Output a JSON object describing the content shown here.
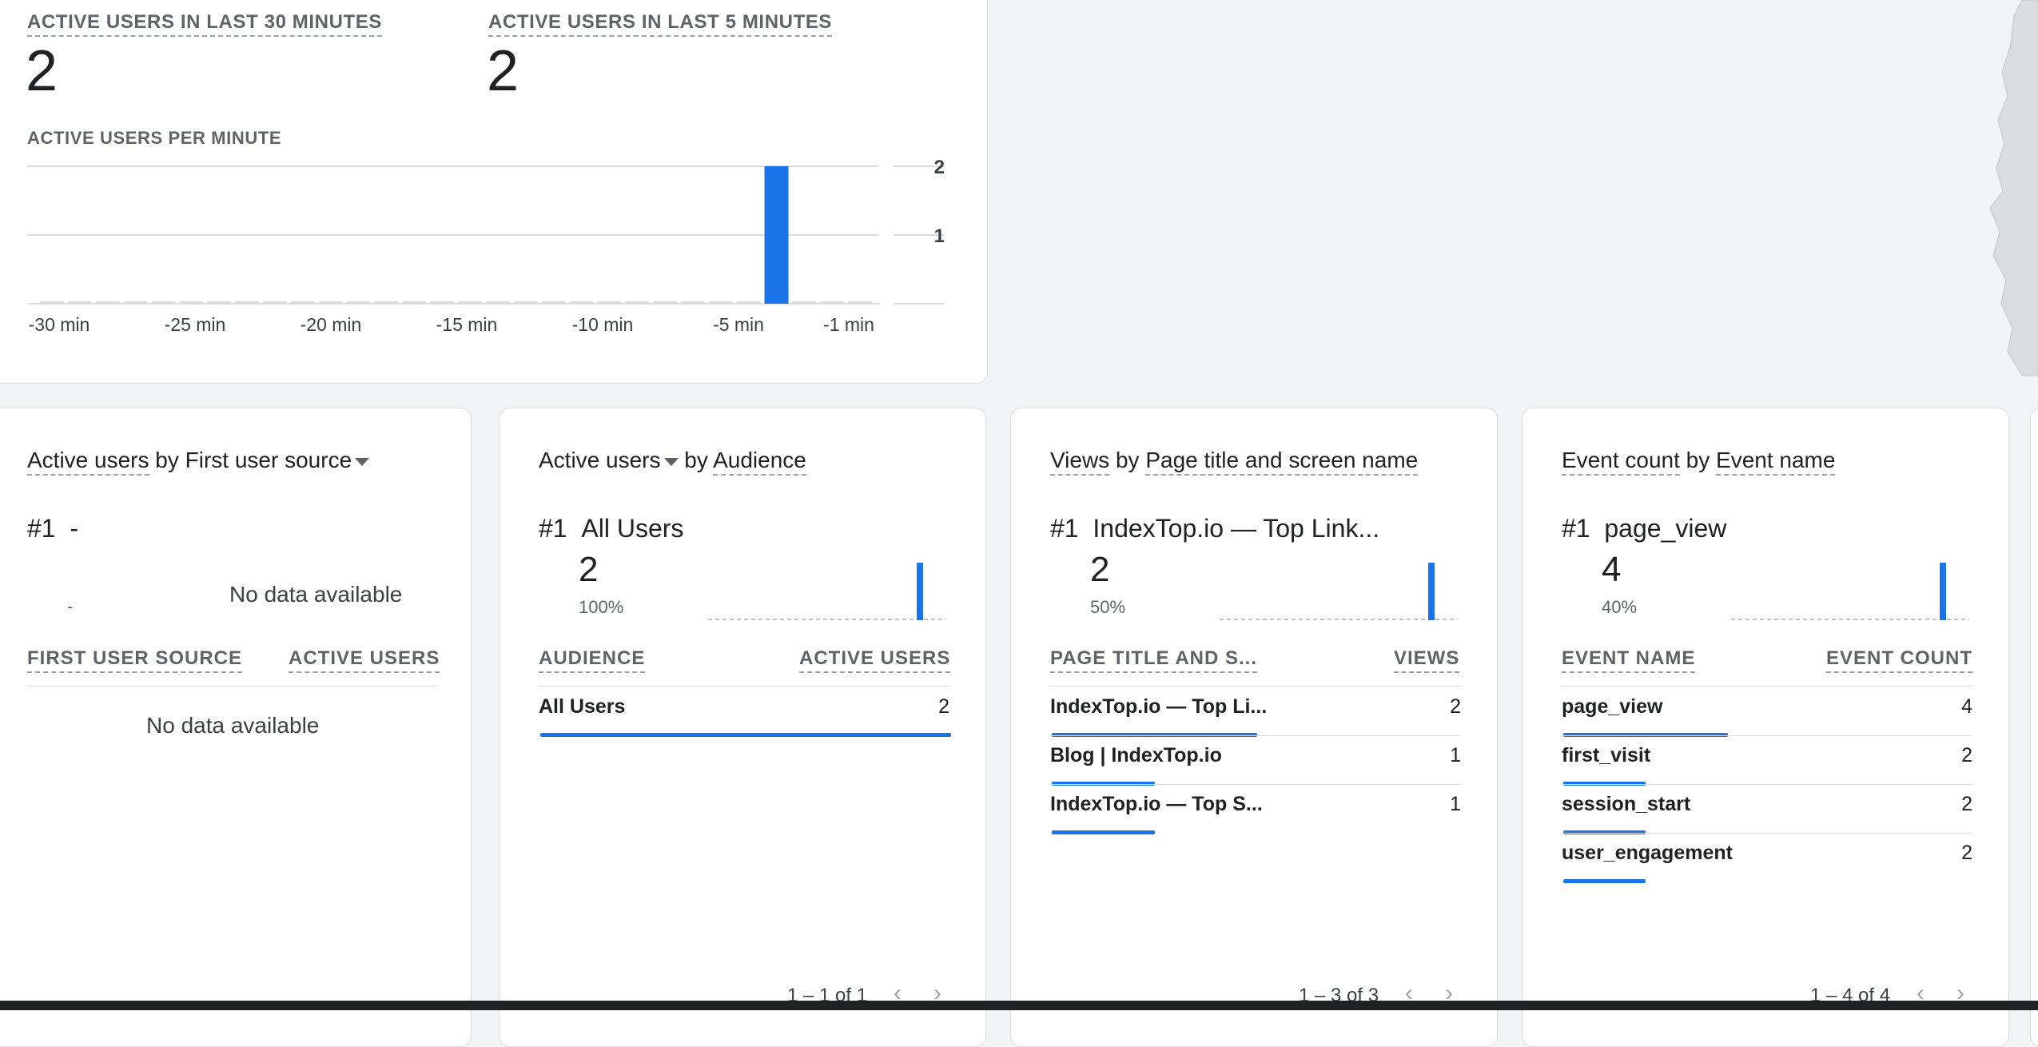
{
  "realtime": {
    "active_30_label": "ACTIVE USERS IN LAST 30 MINUTES",
    "active_30_value": "2",
    "active_5_label": "ACTIVE USERS IN LAST 5 MINUTES",
    "active_5_value": "2",
    "per_minute_label": "ACTIVE USERS PER MINUTE"
  },
  "chart_data": {
    "type": "bar",
    "title": "ACTIVE USERS PER MINUTE",
    "x_tick_labels": [
      "-30 min",
      "-25 min",
      "-20 min",
      "-15 min",
      "-10 min",
      "-5 min",
      "-1 min"
    ],
    "y_tick_labels": [
      "2",
      "1"
    ],
    "ylim": [
      0,
      2
    ],
    "categories": [
      -30,
      -29,
      -28,
      -27,
      -26,
      -25,
      -24,
      -23,
      -22,
      -21,
      -20,
      -19,
      -18,
      -17,
      -16,
      -15,
      -14,
      -13,
      -12,
      -11,
      -10,
      -9,
      -8,
      -7,
      -6,
      -5,
      -4,
      -3,
      -2,
      -1
    ],
    "values": [
      0,
      0,
      0,
      0,
      0,
      0,
      0,
      0,
      0,
      0,
      0,
      0,
      0,
      0,
      0,
      0,
      0,
      0,
      0,
      0,
      0,
      0,
      0,
      0,
      0,
      0,
      2,
      0,
      0,
      0
    ],
    "grid": true,
    "accent_color": "#1a73e8"
  },
  "cards": {
    "source": {
      "title_metric": "Active users",
      "title_by": "by",
      "title_dim": "First user source",
      "rank": "#1",
      "rank_value": "-",
      "spark_value": "-",
      "spark_nodata": "No data available",
      "col1": "FIRST USER SOURCE",
      "col2": "ACTIVE USERS",
      "table_nodata": "No data available"
    },
    "audience": {
      "title_metric": "Active users",
      "title_by": "by",
      "title_dim": "Audience",
      "rank": "#1",
      "rank_value": "All Users",
      "value": "2",
      "pct": "100%",
      "col1": "AUDIENCE",
      "col2": "ACTIVE USERS",
      "rows": [
        {
          "label": "All Users",
          "value": "2",
          "fraction": 1.0
        }
      ],
      "pager": "1 – 1 of 1"
    },
    "views": {
      "title_metric": "Views",
      "title_by": "by",
      "title_dim": "Page title and screen name",
      "rank": "#1",
      "rank_value": "IndexTop.io — Top Link...",
      "value": "2",
      "pct": "50%",
      "col1": "PAGE TITLE AND S...",
      "col2": "VIEWS",
      "rows": [
        {
          "label": "IndexTop.io — Top Li...",
          "value": "2",
          "fraction": 0.5
        },
        {
          "label": "Blog | IndexTop.io",
          "value": "1",
          "fraction": 0.25
        },
        {
          "label": "IndexTop.io — Top S...",
          "value": "1",
          "fraction": 0.25
        }
      ],
      "pager": "1 – 3 of 3"
    },
    "events": {
      "title_metric": "Event count",
      "title_by": "by",
      "title_dim": "Event name",
      "rank": "#1",
      "rank_value": "page_view",
      "value": "4",
      "pct": "40%",
      "col1": "EVENT NAME",
      "col2": "EVENT COUNT",
      "rows": [
        {
          "label": "page_view",
          "value": "4",
          "fraction": 0.4
        },
        {
          "label": "first_visit",
          "value": "2",
          "fraction": 0.2
        },
        {
          "label": "session_start",
          "value": "2",
          "fraction": 0.2
        },
        {
          "label": "user_engagement",
          "value": "2",
          "fraction": 0.2
        }
      ],
      "pager": "1 – 4 of 4"
    }
  },
  "icons": {
    "prev": "chevron-left-icon",
    "next": "chevron-right-icon",
    "dropdown": "caret-down-icon"
  }
}
